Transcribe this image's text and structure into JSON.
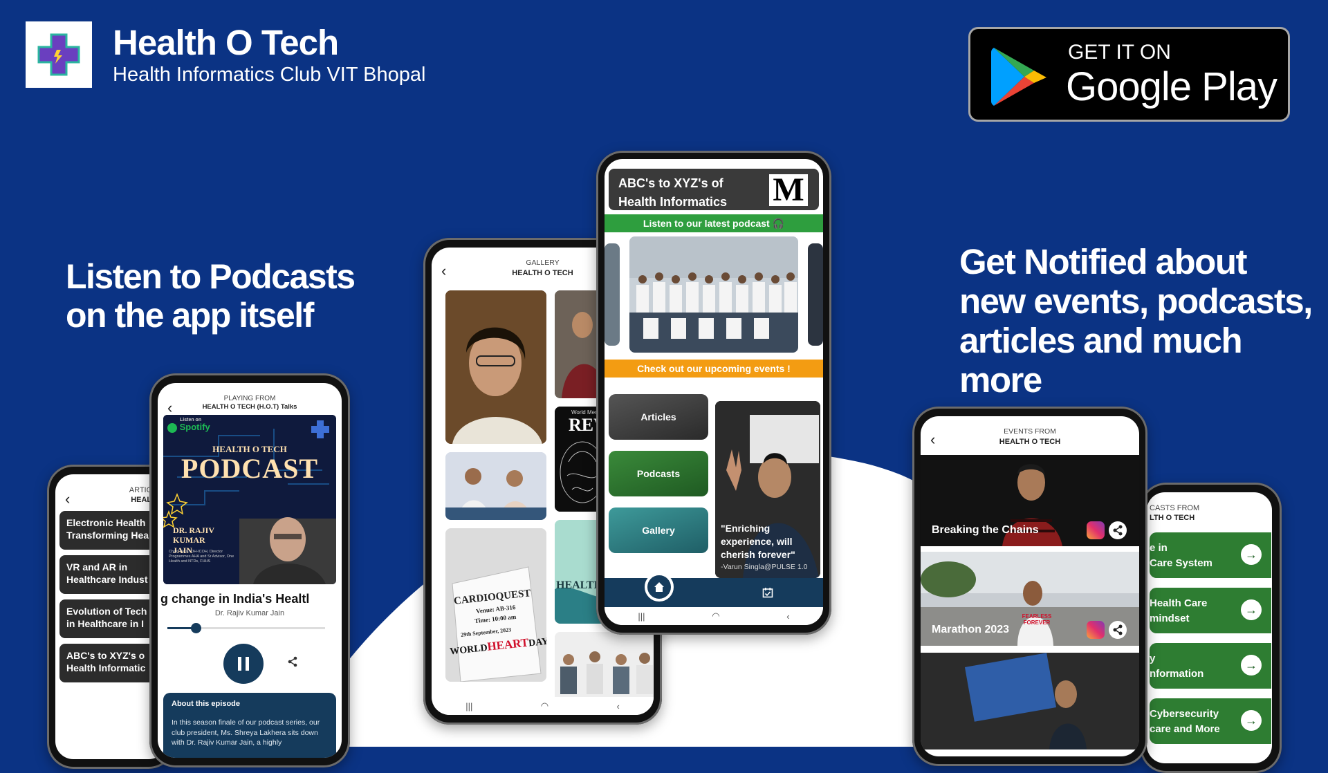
{
  "brand": {
    "title": "Health O Tech",
    "subtitle": "Health Informatics Club VIT Bhopal"
  },
  "store_badge": {
    "small": "GET IT ON",
    "big": "Google Play"
  },
  "headlines": {
    "left": "Listen to Podcasts on the app itself",
    "right": "Get Notified about new events, podcasts, articles and much more"
  },
  "articles_screen": {
    "header_line1": "ARTICLE",
    "header_line2": "HEALTH",
    "items": [
      "Electronic Health",
      "Transforming Hea",
      "VR and AR in",
      "Healthcare Indust",
      "Evolution of Tech",
      "in Healthcare in I",
      "ABC's to XYZ's o",
      "Health Informatic"
    ]
  },
  "player_screen": {
    "header_line1": "PLAYING FROM",
    "header_line2": "HEALTH O TECH (H.O.T) Talks",
    "art": {
      "listen_on": "Listen on",
      "spotify": "Spotify",
      "brand": "HEALTH O TECH",
      "word": "PODCAST",
      "guest": "DR. RAJIV KUMAR JAIN",
      "guest_bio": "Chair, ISCETOH-ICOH, Director Programmes AHA and Sr Advisor, One Health and NTDs, FHHS"
    },
    "episode_title": "g change in India's Healtl",
    "host": "Dr. Rajiv Kumar Jain",
    "progress": 0.18,
    "about_title": "About this episode",
    "about_text": "In this season finale of our podcast series, our club president, Ms. Shreya Lakhera sits down with Dr. Rajiv Kumar Jain, a highly"
  },
  "gallery_screen": {
    "header_line1": "GALLERY",
    "header_line2": "HEALTH O TECH",
    "tiles": {
      "rev": "REV",
      "world_mental": "World Men",
      "health": "HEALTI",
      "cardio_title": "CARDIOQUEST",
      "cardio_venue": "Venue: AB-316",
      "cardio_time": "Time: 10:00 am",
      "cardio_date": "29th September, 2023",
      "cardio_world": "WORLD",
      "cardio_heart": "HEART",
      "cardio_day": "DAY"
    }
  },
  "home_screen": {
    "banner_line1": "ABC's to XYZ's of",
    "banner_line2": "Health Informatics",
    "medium_logo": "M",
    "podcast_strip": "Listen to our latest podcast",
    "events_strip": "Check out our upcoming events !",
    "tiles": [
      "Articles",
      "Podcasts",
      "Gallery"
    ],
    "quote": "\"Enriching experience, will cherish forever\"",
    "quote_author": "-Varun Singla@PULSE 1.0"
  },
  "events_screen": {
    "header_line1": "EVENTS FROM",
    "header_line2": "HEALTH O TECH",
    "events": [
      "Breaking the Chains",
      "Marathon 2023"
    ],
    "shirt_text": "FEARLESS FOREVER"
  },
  "podcasts_screen": {
    "header_line1": "CASTS FROM",
    "header_line2": "LTH O TECH",
    "items": [
      {
        "l1": "e in",
        "l2": "Care System"
      },
      {
        "l1": "Health Care",
        "l2": "mindset"
      },
      {
        "l1": "y",
        "l2": "nformation"
      },
      {
        "l1": "Cybersecurity",
        "l2": "care and More"
      }
    ]
  },
  "colors": {
    "background": "#0b3384",
    "accent_navy": "#153b5c",
    "green": "#2e7d32",
    "orange": "#f39c12"
  }
}
